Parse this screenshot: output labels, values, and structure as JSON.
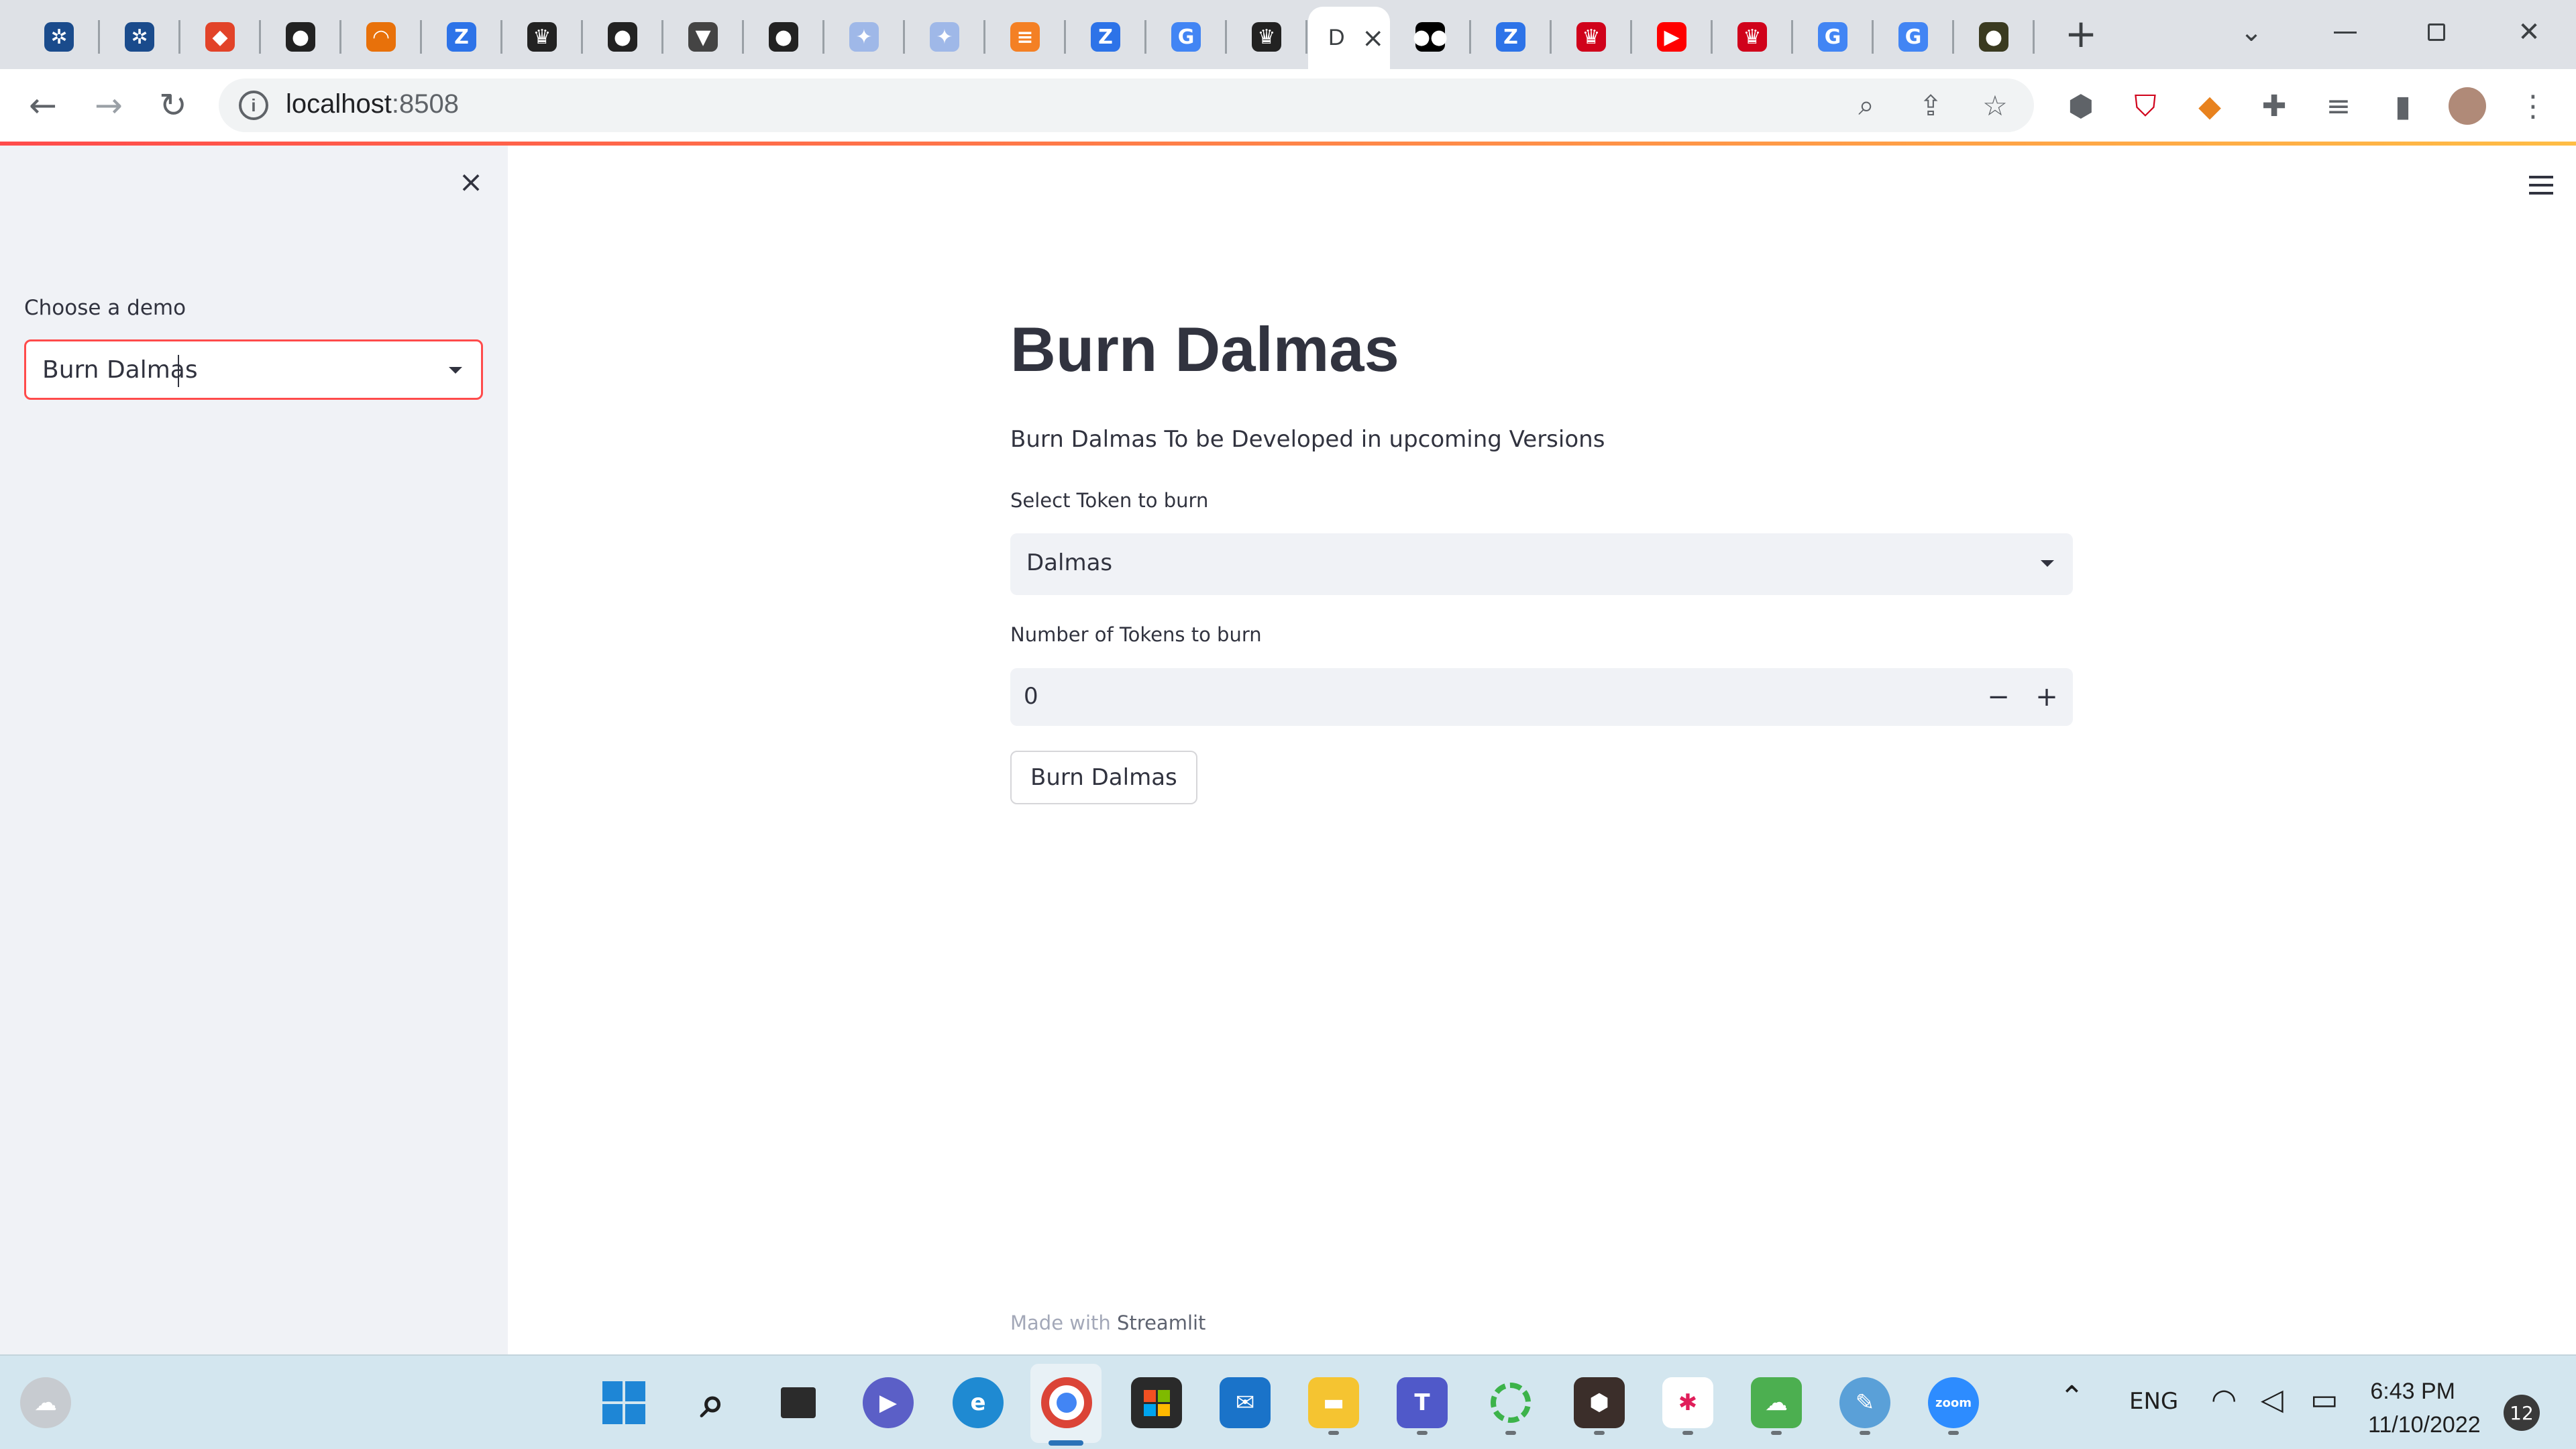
{
  "browser": {
    "tabs": [
      {
        "icon": "tree-icon",
        "color": "#1a4b8c",
        "glyph": "✲"
      },
      {
        "icon": "tree-icon",
        "color": "#1a4b8c",
        "glyph": "✲"
      },
      {
        "icon": "gitlab-icon",
        "color": "#e24329",
        "glyph": "◆"
      },
      {
        "icon": "brain-icon",
        "color": "#222222",
        "glyph": "●"
      },
      {
        "icon": "spinner-icon",
        "color": "#e8710a",
        "glyph": "◠"
      },
      {
        "icon": "zoho-icon",
        "color": "#2d73e8",
        "glyph": "Z"
      },
      {
        "icon": "crown-icon",
        "color": "#222222",
        "glyph": "♛"
      },
      {
        "icon": "github-icon",
        "color": "#222222",
        "glyph": "●"
      },
      {
        "icon": "brave-icon",
        "color": "#444444",
        "glyph": "▼"
      },
      {
        "icon": "github-icon",
        "color": "#222222",
        "glyph": "●"
      },
      {
        "icon": "bulb-icon",
        "color": "#9fb8e8",
        "glyph": "✦"
      },
      {
        "icon": "bulb-icon",
        "color": "#9fb8e8",
        "glyph": "✦"
      },
      {
        "icon": "stackoverflow-icon",
        "color": "#f48024",
        "glyph": "≡"
      },
      {
        "icon": "zoho-icon",
        "color": "#2d73e8",
        "glyph": "Z"
      },
      {
        "icon": "google-icon",
        "color": "#4285f4",
        "glyph": "G"
      },
      {
        "icon": "crown-icon",
        "color": "#222222",
        "glyph": "♛"
      }
    ],
    "active_tab": {
      "title": "D",
      "close": "×"
    },
    "tabs_after": [
      {
        "icon": "medium-icon",
        "color": "#000000",
        "glyph": "●●"
      },
      {
        "icon": "zoho-icon",
        "color": "#2d73e8",
        "glyph": "Z"
      },
      {
        "icon": "crown-red-icon",
        "color": "#d0021b",
        "glyph": "♛"
      },
      {
        "icon": "youtube-icon",
        "color": "#ff0000",
        "glyph": "▶"
      },
      {
        "icon": "crown-red-icon",
        "color": "#d0021b",
        "glyph": "♛"
      },
      {
        "icon": "google-icon",
        "color": "#4285f4",
        "glyph": "G"
      },
      {
        "icon": "google-icon",
        "color": "#4285f4",
        "glyph": "G"
      },
      {
        "icon": "spy-icon",
        "color": "#3a3a20",
        "glyph": "●"
      }
    ],
    "new_tab": "+",
    "url_host": "localhost",
    "url_port": ":8508"
  },
  "sidebar": {
    "close": "×",
    "label": "Choose a demo",
    "selected": "Burn Dalmas"
  },
  "main": {
    "title": "Burn Dalmas",
    "description": "Burn Dalmas To be Developed in upcoming Versions",
    "token_label": "Select Token to burn",
    "token_value": "Dalmas",
    "amount_label": "Number of Tokens to burn",
    "amount_value": "0",
    "minus": "−",
    "plus": "+",
    "button": "Burn Dalmas"
  },
  "footer": {
    "prefix": "Made with ",
    "brand": "Streamlit"
  },
  "taskbar": {
    "language": "ENG",
    "time": "6:43 PM",
    "date": "11/10/2022",
    "notifications": "12",
    "zoom_label": "zoom"
  },
  "colors": {
    "accent": "#ff4b4b",
    "sidebar_bg": "#f0f2f6",
    "text": "#31333f"
  }
}
